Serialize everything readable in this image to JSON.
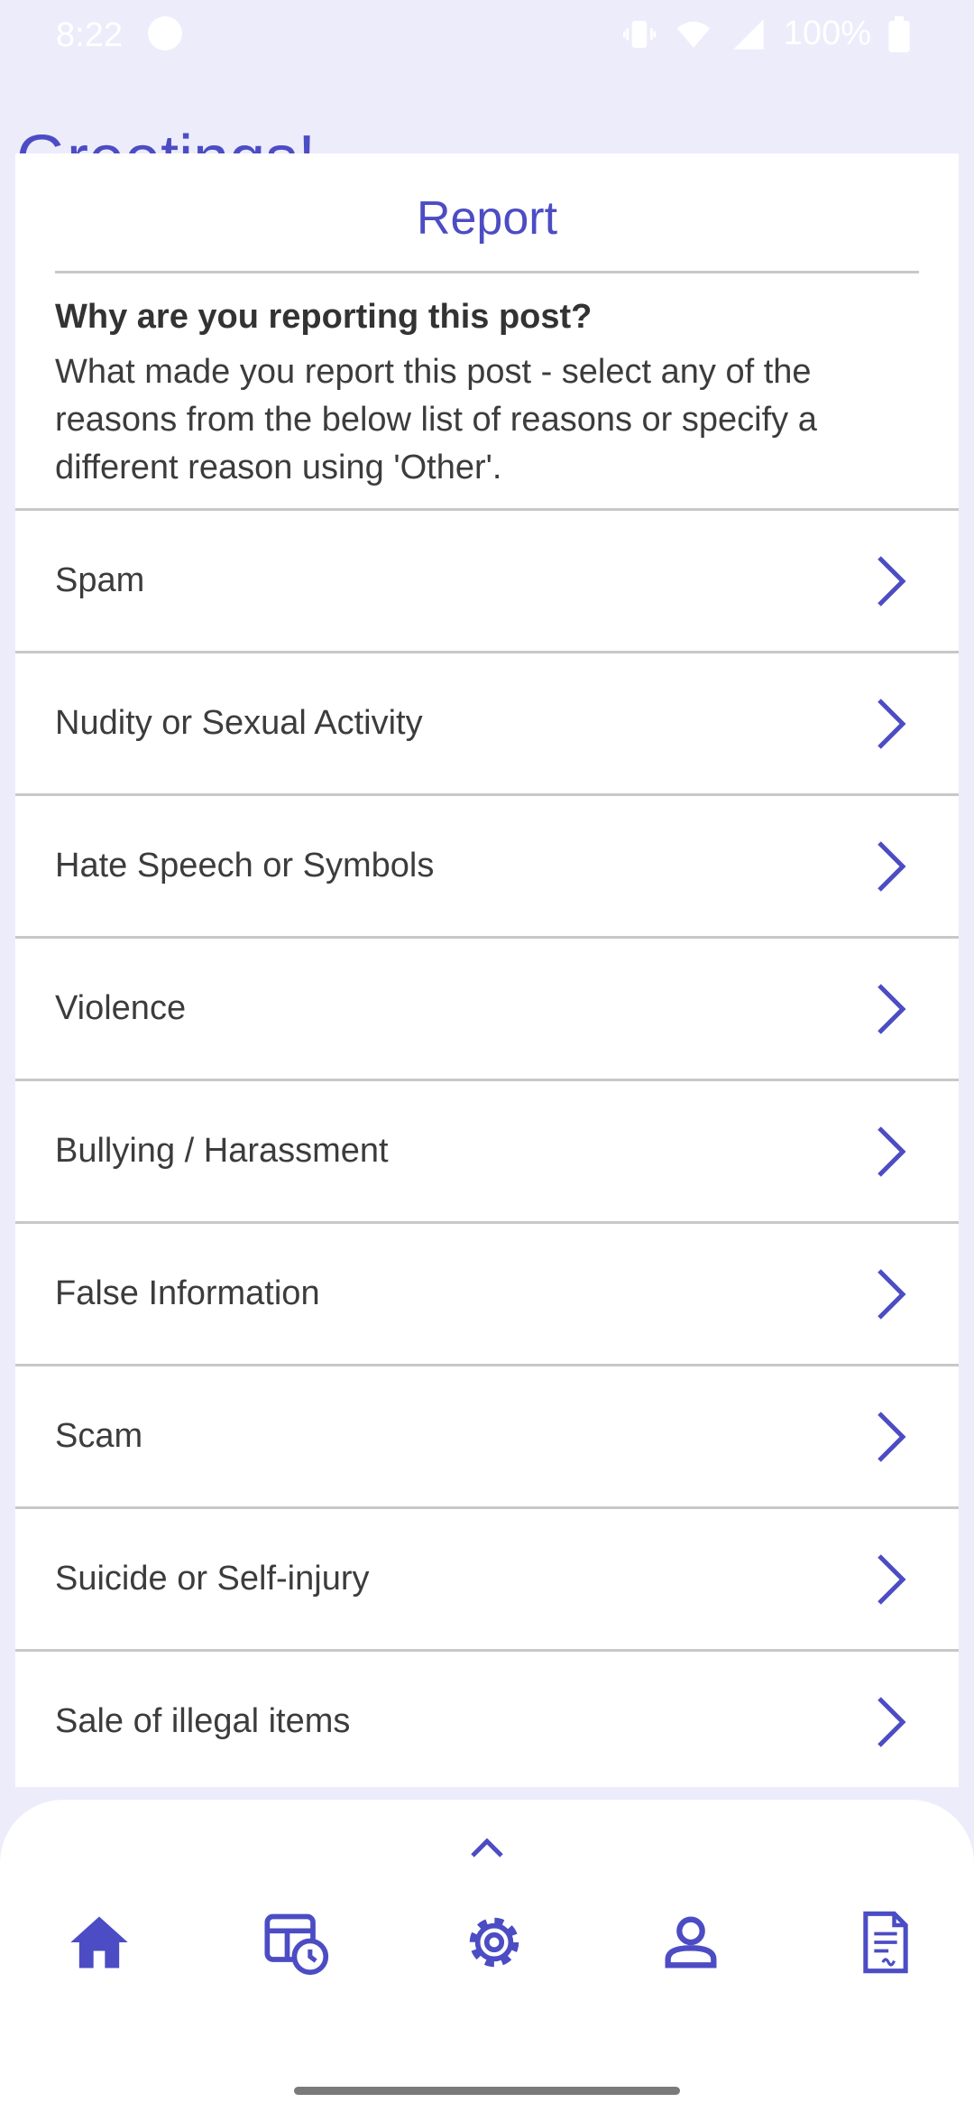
{
  "status_bar": {
    "time": "8:22",
    "battery": "100%"
  },
  "background": {
    "greeting": "Greetings!"
  },
  "report_sheet": {
    "title": "Report",
    "question": "Why are you reporting this post?",
    "description": "What made you report this post - select any of the reasons from the below list of reasons or specify a different reason using 'Other'.",
    "reasons": [
      {
        "label": "Spam",
        "icon": "chevron-right-icon"
      },
      {
        "label": "Nudity or Sexual Activity",
        "icon": "chevron-right-icon"
      },
      {
        "label": "Hate Speech or Symbols",
        "icon": "chevron-right-icon"
      },
      {
        "label": "Violence",
        "icon": "chevron-right-icon"
      },
      {
        "label": "Bullying / Harassment",
        "icon": "chevron-right-icon"
      },
      {
        "label": "False Information",
        "icon": "chevron-right-icon"
      },
      {
        "label": "Scam",
        "icon": "chevron-right-icon"
      },
      {
        "label": "Suicide or Self-injury",
        "icon": "chevron-right-icon"
      },
      {
        "label": "Sale of illegal items",
        "icon": "chevron-right-icon"
      }
    ]
  },
  "bottom_nav": {
    "items": [
      {
        "icon": "home-icon"
      },
      {
        "icon": "calendar-clock-icon"
      },
      {
        "icon": "gear-icon"
      },
      {
        "icon": "person-icon"
      },
      {
        "icon": "document-icon"
      }
    ],
    "expand_icon": "chevron-up-icon"
  },
  "colors": {
    "accent": "#4c4cc4",
    "background": "#ececfb",
    "divider": "#c8c8c8",
    "text": "#3c3c3c"
  }
}
